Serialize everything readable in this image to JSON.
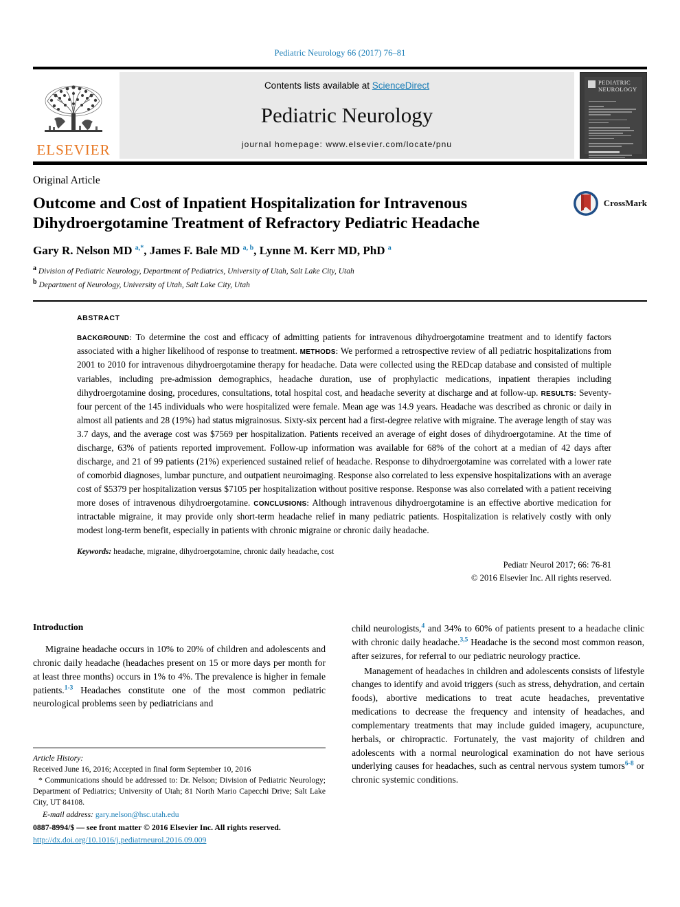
{
  "running_head": "Pediatric Neurology 66 (2017) 76–81",
  "masthead": {
    "publisher_name": "ELSEVIER",
    "contents_prefix": "Contents lists available at ",
    "contents_link": "ScienceDirect",
    "journal_title": "Pediatric Neurology",
    "homepage": "journal homepage: www.elsevier.com/locate/pnu",
    "cover_title_line1": "PEDIATRIC",
    "cover_title_line2": "NEUROLOGY"
  },
  "article": {
    "type": "Original Article",
    "title": "Outcome and Cost of Inpatient Hospitalization for Intravenous Dihydroergotamine Treatment of Refractory Pediatric Headache",
    "authors_html": "Gary R. Nelson MD <sup>a,</sup><sup>*</sup>, James F. Bale MD <sup>a, b</sup>, Lynne M. Kerr MD, PhD <sup>a</sup>",
    "affiliation_a": "Division of Pediatric Neurology, Department of Pediatrics, University of Utah, Salt Lake City, Utah",
    "affiliation_b": "Department of Neurology, University of Utah, Salt Lake City, Utah",
    "crossmark_label": "CrossMark"
  },
  "abstract": {
    "label": "ABSTRACT",
    "sections": [
      {
        "head": "BACKGROUND:",
        "text": " To determine the cost and efficacy of admitting patients for intravenous dihydroergotamine treatment and to identify factors associated with a higher likelihood of response to treatment. "
      },
      {
        "head": "METHODS:",
        "text": " We performed a retrospective review of all pediatric hospitalizations from 2001 to 2010 for intravenous dihydroergotamine therapy for headache. Data were collected using the REDcap database and consisted of multiple variables, including pre-admission demographics, headache duration, use of prophylactic medications, inpatient therapies including dihydroergotamine dosing, procedures, consultations, total hospital cost, and headache severity at discharge and at follow-up. "
      },
      {
        "head": "RESULTS:",
        "text": " Seventy-four percent of the 145 individuals who were hospitalized were female. Mean age was 14.9 years. Headache was described as chronic or daily in almost all patients and 28 (19%) had status migrainosus. Sixty-six percent had a first-degree relative with migraine. The average length of stay was 3.7 days, and the average cost was $7569 per hospitalization. Patients received an average of eight doses of dihydroergotamine. At the time of discharge, 63% of patients reported improvement. Follow-up information was available for 68% of the cohort at a median of 42 days after discharge, and 21 of 99 patients (21%) experienced sustained relief of headache. Response to dihydroergotamine was correlated with a lower rate of comorbid diagnoses, lumbar puncture, and outpatient neuroimaging. Response also correlated to less expensive hospitalizations with an average cost of $5379 per hospitalization versus $7105 per hospitalization without positive response. Response was also correlated with a patient receiving more doses of intravenous dihydroergotamine. "
      },
      {
        "head": "CONCLUSIONS:",
        "text": " Although intravenous dihydroergotamine is an effective abortive medication for intractable migraine, it may provide only short-term headache relief in many pediatric patients. Hospitalization is relatively costly with only modest long-term benefit, especially in patients with chronic migraine or chronic daily headache."
      }
    ],
    "keywords_label": "Keywords:",
    "keywords_value": " headache, migraine, dihydroergotamine, chronic daily headache, cost",
    "citation": "Pediatr Neurol 2017; 66: 76-81",
    "copyright": "© 2016 Elsevier Inc. All rights reserved."
  },
  "body": {
    "intro_heading": "Introduction",
    "left_para1_html": "Migraine headache occurs in 10% to 20% of children and adolescents and chronic daily headache (headaches present on 15 or more days per month for at least three months) occurs in 1% to 4%. The prevalence is higher in female patients.<sup class=\"ref\">1-3</sup> Headaches constitute one of the most common pediatric neurological problems seen by pediatricians and",
    "right_para1_html": "child neurologists,<sup class=\"ref\">4</sup> and 34% to 60% of patients present to a headache clinic with chronic daily headache.<sup class=\"ref\">3,5</sup> Headache is the second most common reason, after seizures, for referral to our pediatric neurology practice.",
    "right_para2_html": "Management of headaches in children and adolescents consists of lifestyle changes to identify and avoid triggers (such as stress, dehydration, and certain foods), abortive medications to treat acute headaches, preventative medications to decrease the frequency and intensity of headaches, and complementary treatments that may include guided imagery, acupuncture, herbals, or chiropractic. Fortunately, the vast majority of children and adolescents with a normal neurological examination do not have serious underlying causes for headaches, such as central nervous system tumors<sup class=\"ref\">6-8</sup> or chronic systemic conditions."
  },
  "footnotes": {
    "history_label": "Article History:",
    "history_value": "Received June 16, 2016; Accepted in final form September 10, 2016",
    "correspondence": "* Communications should be addressed to: Dr. Nelson; Division of Pediatric Neurology; Department of Pediatrics; University of Utah; 81 North Mario Capecchi Drive; Salt Lake City, UT 84108.",
    "email_label": "E-mail address:",
    "email_value": "gary.nelson@hsc.utah.edu",
    "issn_line": "0887-8994/$ — see front matter © 2016 Elsevier Inc. All rights reserved.",
    "doi_line": "http://dx.doi.org/10.1016/j.pediatrneurol.2016.09.009"
  },
  "colors": {
    "link_blue": "#1a7db6",
    "elsevier_orange": "#E87722",
    "band_gray": "#e9e9e9"
  }
}
